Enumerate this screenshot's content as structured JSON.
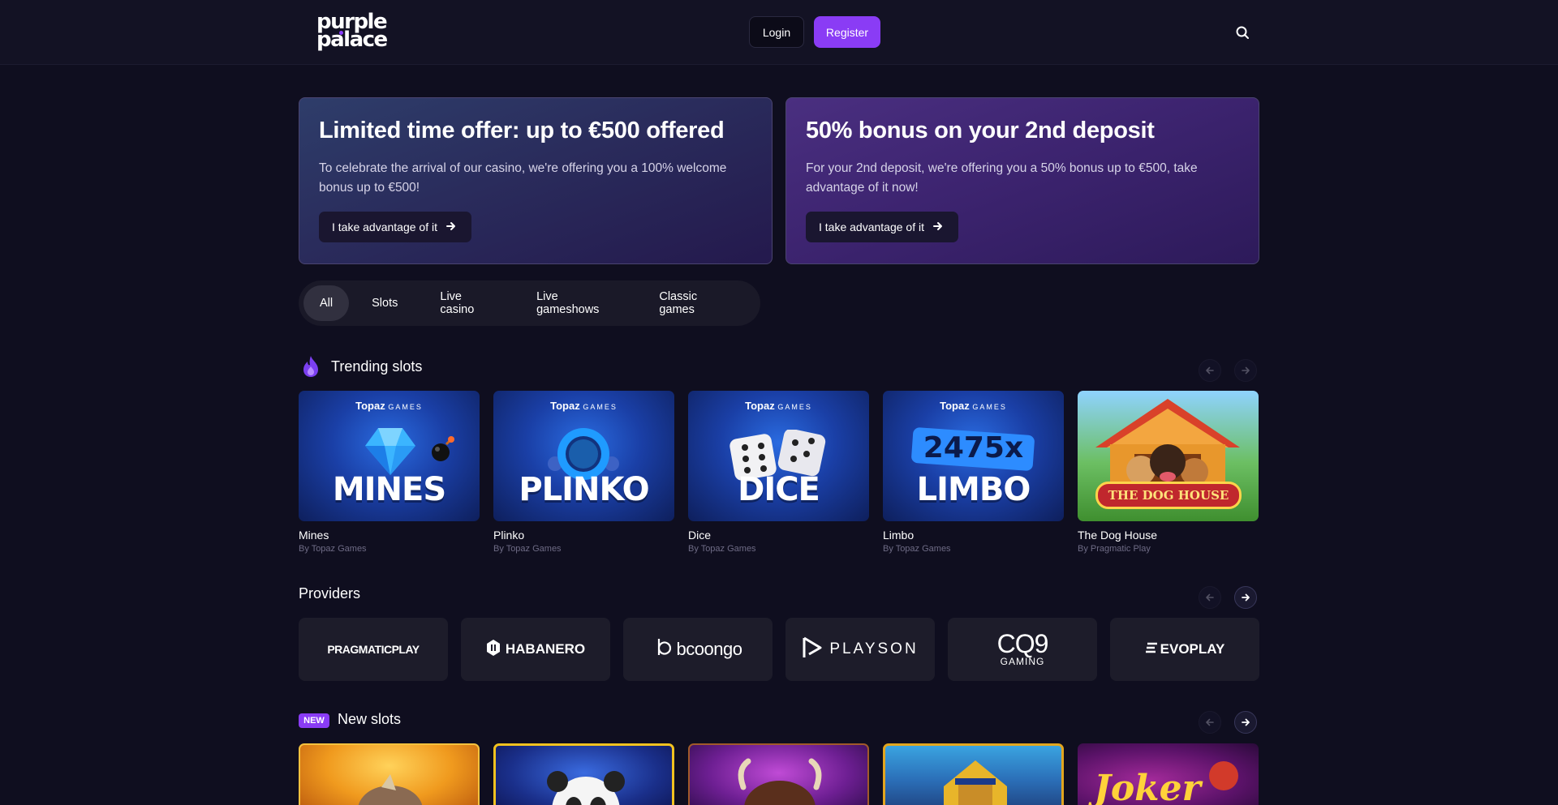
{
  "header": {
    "logo_line1": "purple",
    "logo_line2": "palace",
    "login_label": "Login",
    "register_label": "Register"
  },
  "promos": [
    {
      "title": "Limited time offer: up to €500 offered",
      "text": "To celebrate the arrival of our casino, we're offering you a 100% welcome bonus up to €500!",
      "button": "I take advantage of it"
    },
    {
      "title": "50% bonus on your 2nd deposit",
      "text": "For your 2nd deposit, we're offering you a 50% bonus up to €500, take advantage of it now!",
      "button": "I take advantage of it"
    }
  ],
  "tabs": [
    "All",
    "Slots",
    "Live casino",
    "Live gameshows",
    "Classic games"
  ],
  "trending": {
    "title": "Trending slots",
    "games": [
      {
        "name": "Mines",
        "provider": "By Topaz Games",
        "art": "MINES",
        "brand": "Topaz",
        "brand_suffix": "GAMES"
      },
      {
        "name": "Plinko",
        "provider": "By Topaz Games",
        "art": "PLINKO",
        "brand": "Topaz",
        "brand_suffix": "GAMES"
      },
      {
        "name": "Dice",
        "provider": "By Topaz Games",
        "art": "DICE",
        "brand": "Topaz",
        "brand_suffix": "GAMES"
      },
      {
        "name": "Limbo",
        "provider": "By Topaz Games",
        "art": "LIMBO",
        "art_top": "2475x",
        "brand": "Topaz",
        "brand_suffix": "GAMES"
      },
      {
        "name": "The Dog House",
        "provider": "By Pragmatic Play",
        "art": "THE DOG HOUSE"
      }
    ]
  },
  "providers": {
    "title": "Providers",
    "items": [
      "PRAGMATICPLAY",
      "HABANERO",
      "bcoongo",
      "PLAYSON",
      "CQ9",
      "EVOPLAY"
    ],
    "cq9_sub": "GAMING"
  },
  "new_slots": {
    "badge": "NEW",
    "title": "New slots"
  },
  "colors": {
    "accent": "#8a3cf5",
    "background": "#0f0e1f",
    "header": "#131224"
  }
}
